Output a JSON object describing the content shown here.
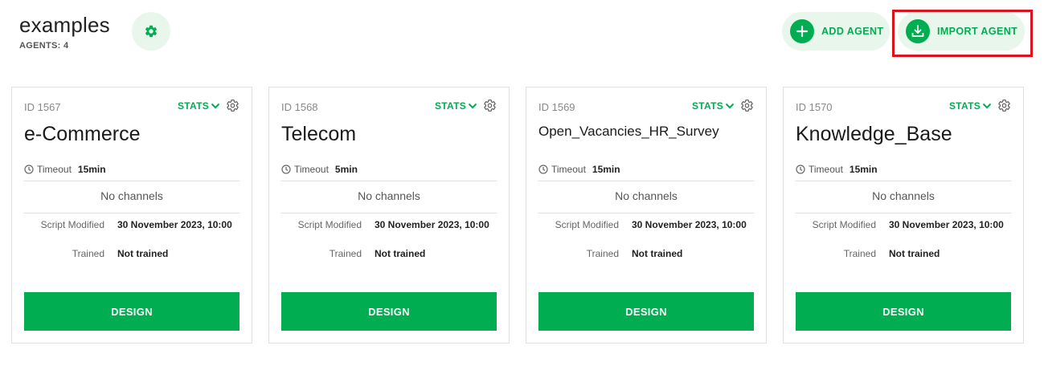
{
  "header": {
    "title": "examples",
    "agents_count": "AGENTS: 4"
  },
  "actions": {
    "add_agent": "ADD AGENT",
    "import_agent": "IMPORT AGENT"
  },
  "colors": {
    "accent": "#00ad50",
    "accent_light": "#e8f6ec",
    "highlight": "#d9141c"
  },
  "labels": {
    "stats": "STATS",
    "timeout": "Timeout",
    "no_channels": "No channels",
    "script_modified": "Script Modified",
    "trained": "Trained",
    "design": "DESIGN"
  },
  "agents": [
    {
      "id": "ID 1567",
      "name": "e-Commerce",
      "timeout": "15min",
      "script_modified": "30 November 2023, 10:00",
      "trained": "Not trained"
    },
    {
      "id": "ID 1568",
      "name": "Telecom",
      "timeout": "5min",
      "script_modified": "30 November 2023, 10:00",
      "trained": "Not trained"
    },
    {
      "id": "ID 1569",
      "name": "Open_Vacancies_HR_Survey",
      "timeout": "15min",
      "script_modified": "30 November 2023, 10:00",
      "trained": "Not trained"
    },
    {
      "id": "ID 1570",
      "name": "Knowledge_Base",
      "timeout": "15min",
      "script_modified": "30 November 2023, 10:00",
      "trained": "Not trained"
    }
  ]
}
